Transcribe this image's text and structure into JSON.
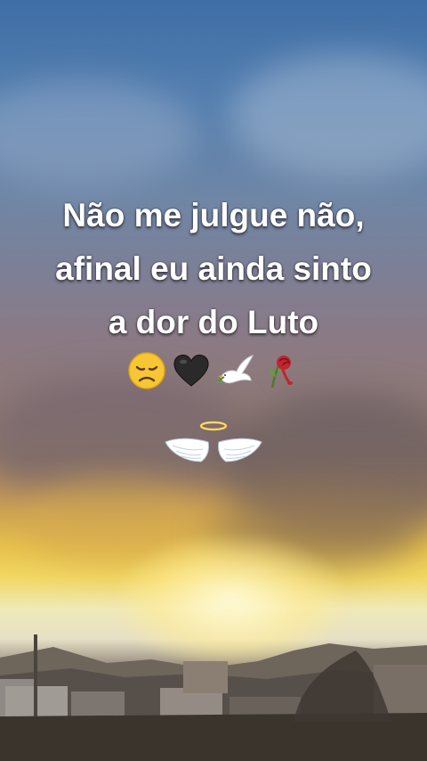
{
  "caption": {
    "line1": "Não me julgue não,",
    "line2": "afinal eu ainda sinto",
    "line3": "a dor do Luto"
  },
  "emojis": [
    "disappointed-face-icon",
    "black-heart-icon",
    "dove-icon",
    "wilted-rose-icon"
  ],
  "decoration": [
    "halo-icon",
    "angel-wings-icon"
  ],
  "colors": {
    "sky_top": "#3e6ea6",
    "sunset_glow": "#f2d864",
    "text": "#ffffff"
  }
}
